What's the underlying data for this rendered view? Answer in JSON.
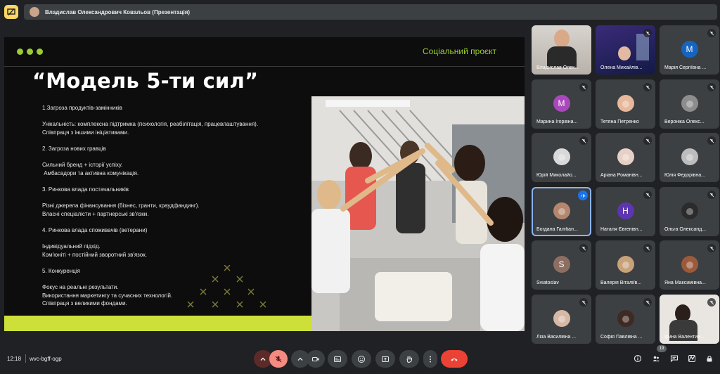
{
  "topbar": {
    "presenter_label": "Владислав Олександрович Ковальов (Презентація)"
  },
  "slide": {
    "header": "Соціальний проєкт",
    "title": "“Модель 5-ти сил”",
    "lines": [
      "1.Загроза продуктів-замінників",
      "",
      "Унікальність: комплексна підтримка (психологія, реабілітація, працевлаштування).",
      "Співпраця з іншими ініціативами.",
      "",
      "2. Загроза нових гравців",
      "",
      "Сильний бренд + історії успіху.",
      " Амбасадори та активна комунікація.",
      "",
      "3. Ринкова влада постачальників",
      "",
      "Різні джерела фінансування (бізнес, гранти, краудфандинг).",
      "Власні спеціалісти + партнерські зв'язки.",
      "",
      "4. Ринкова влада споживачів (ветерани)",
      "",
      "Індивідуальний підхід.",
      "Ком'юніті + постійний зворотний зв'язок.",
      "",
      "5. Конкуренція",
      "",
      "Фокус на реальні результати.",
      "Використання маркетингу та сучасних технологій.",
      "Співпраця з великими фондами."
    ],
    "accent_color": "#9acd32",
    "bar_color": "#cde03a"
  },
  "participants": [
    {
      "name": "Владислав Олек...",
      "type": "video",
      "muted": false
    },
    {
      "name": "Олена Михайлів...",
      "type": "video",
      "muted": true
    },
    {
      "name": "Марія Сергіївна ...",
      "type": "letter",
      "letter": "M",
      "color": "#1565c0",
      "muted": true
    },
    {
      "name": "Марина Ігорівна...",
      "type": "letter",
      "letter": "M",
      "color": "#ab47bc",
      "muted": true
    },
    {
      "name": "Тетяна Петренко",
      "type": "photo",
      "color": "#e6b89c",
      "muted": true
    },
    {
      "name": "Вероніка Олекс...",
      "type": "photo",
      "color": "#8d8d8d",
      "muted": true
    },
    {
      "name": "Юрій Миколайо...",
      "type": "photo",
      "color": "#d9d9d9",
      "muted": true
    },
    {
      "name": "Аріана Романівн...",
      "type": "photo",
      "color": "#e7d0c5",
      "muted": true
    },
    {
      "name": "Юлія Федорівна...",
      "type": "photo",
      "color": "#bdbdbd",
      "muted": true
    },
    {
      "name": "Богдана Галібан...",
      "type": "photo",
      "color": "#b5866e",
      "muted": false,
      "speaking": true
    },
    {
      "name": "Наталя Євгенівн...",
      "type": "letter",
      "letter": "H",
      "color": "#5e35b1",
      "muted": true
    },
    {
      "name": "Ольга Олександ...",
      "type": "photo",
      "color": "#2b2b2b",
      "muted": true
    },
    {
      "name": "Sviatoslav",
      "type": "letter",
      "letter": "S",
      "color": "#8d6e63",
      "muted": true
    },
    {
      "name": "Валерія Віталіїв...",
      "type": "photo",
      "color": "#c8a27a",
      "muted": true
    },
    {
      "name": "Яна Максимівна...",
      "type": "photo",
      "color": "#9b5a3c",
      "muted": true
    },
    {
      "name": "Ліза Василівна ...",
      "type": "photo",
      "color": "#d7b8a5",
      "muted": true
    },
    {
      "name": "Софія Павлівна ...",
      "type": "photo",
      "color": "#3e2a22",
      "muted": true
    },
    {
      "name": "Ірина Валентин...",
      "type": "video2",
      "muted": true
    }
  ],
  "bottombar": {
    "time": "12:18",
    "meeting_code": "wvc-bgff-ogp",
    "people_count": "19"
  },
  "icons": {
    "present": "presentation-icon",
    "mic": "mic-off-icon",
    "camera": "camera-icon",
    "captions": "captions-icon",
    "emoji": "emoji-icon",
    "share": "present-screen-icon",
    "hand": "raise-hand-icon",
    "more": "more-vert-icon",
    "leave": "call-end-icon",
    "info": "info-icon",
    "people": "people-icon",
    "chat": "chat-icon",
    "activities": "activities-icon",
    "lock": "host-controls-icon"
  }
}
